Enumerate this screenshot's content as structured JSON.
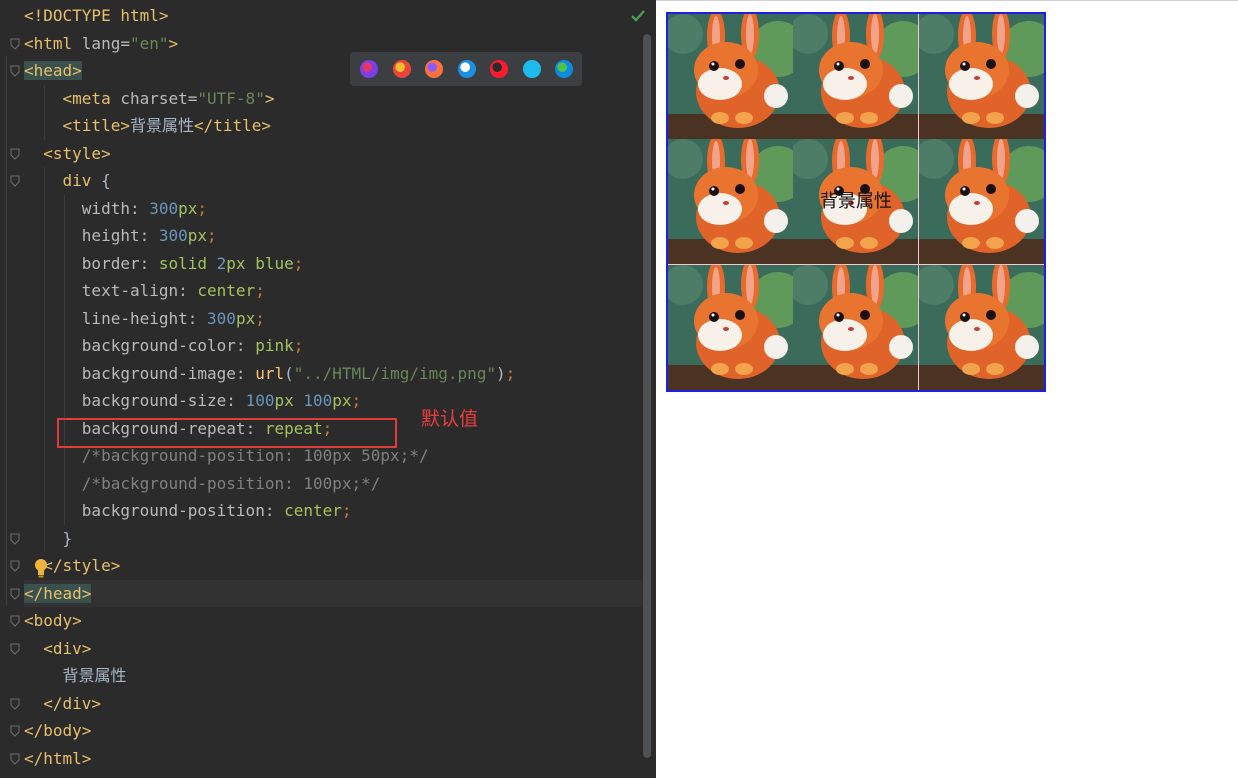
{
  "editor": {
    "lines": [
      [
        {
          "t": "<!DOCTYPE html>",
          "c": "t-doctype"
        }
      ],
      [
        {
          "t": "<html ",
          "c": "t-tag"
        },
        {
          "t": "lang=",
          "c": "t-attr"
        },
        {
          "t": "\"en\"",
          "c": "t-str"
        },
        {
          "t": ">",
          "c": "t-tag"
        }
      ],
      [
        {
          "t": "<head>",
          "c": "t-tag tag-match"
        }
      ],
      [
        {
          "t": "    "
        },
        {
          "t": "<meta ",
          "c": "t-tag"
        },
        {
          "t": "charset=",
          "c": "t-attr"
        },
        {
          "t": "\"UTF-8\"",
          "c": "t-str"
        },
        {
          "t": ">",
          "c": "t-tag"
        }
      ],
      [
        {
          "t": "    "
        },
        {
          "t": "<title>",
          "c": "t-tag"
        },
        {
          "t": "背景属性",
          "c": "t-text"
        },
        {
          "t": "</title>",
          "c": "t-tag"
        }
      ],
      [
        {
          "t": "  "
        },
        {
          "t": "<style>",
          "c": "t-tag"
        }
      ],
      [
        {
          "t": "    "
        },
        {
          "t": "div ",
          "c": "t-tag"
        },
        {
          "t": "{",
          "c": "t-text"
        }
      ],
      [
        {
          "t": "      "
        },
        {
          "t": "width",
          "c": "t-prop"
        },
        {
          "t": ": ",
          "c": "t-text"
        },
        {
          "t": "300",
          "c": "t-num"
        },
        {
          "t": "px",
          "c": "t-kw"
        },
        {
          "t": ";",
          "c": "t-punc"
        }
      ],
      [
        {
          "t": "      "
        },
        {
          "t": "height",
          "c": "t-prop"
        },
        {
          "t": ": ",
          "c": "t-text"
        },
        {
          "t": "300",
          "c": "t-num"
        },
        {
          "t": "px",
          "c": "t-kw"
        },
        {
          "t": ";",
          "c": "t-punc"
        }
      ],
      [
        {
          "t": "      "
        },
        {
          "t": "border",
          "c": "t-prop"
        },
        {
          "t": ": ",
          "c": "t-text"
        },
        {
          "t": "solid ",
          "c": "t-kw"
        },
        {
          "t": "2",
          "c": "t-num"
        },
        {
          "t": "px ",
          "c": "t-kw"
        },
        {
          "t": "blue",
          "c": "t-kw"
        },
        {
          "t": ";",
          "c": "t-punc"
        }
      ],
      [
        {
          "t": "      "
        },
        {
          "t": "text-align",
          "c": "t-prop"
        },
        {
          "t": ": ",
          "c": "t-text"
        },
        {
          "t": "center",
          "c": "t-kw"
        },
        {
          "t": ";",
          "c": "t-punc"
        }
      ],
      [
        {
          "t": "      "
        },
        {
          "t": "line-height",
          "c": "t-prop"
        },
        {
          "t": ": ",
          "c": "t-text"
        },
        {
          "t": "300",
          "c": "t-num"
        },
        {
          "t": "px",
          "c": "t-kw"
        },
        {
          "t": ";",
          "c": "t-punc"
        }
      ],
      [
        {
          "t": "      "
        },
        {
          "t": "background-color",
          "c": "t-prop"
        },
        {
          "t": ": ",
          "c": "t-text"
        },
        {
          "t": "pink",
          "c": "t-kw"
        },
        {
          "t": ";",
          "c": "t-punc"
        }
      ],
      [
        {
          "t": "      "
        },
        {
          "t": "background-image",
          "c": "t-prop"
        },
        {
          "t": ": ",
          "c": "t-text"
        },
        {
          "t": "url",
          "c": "t-fn"
        },
        {
          "t": "(",
          "c": "t-text"
        },
        {
          "t": "\"../HTML/img/img.png\"",
          "c": "t-str"
        },
        {
          "t": ")",
          "c": "t-text"
        },
        {
          "t": ";",
          "c": "t-punc"
        }
      ],
      [
        {
          "t": "      "
        },
        {
          "t": "background-size",
          "c": "t-prop"
        },
        {
          "t": ": ",
          "c": "t-text"
        },
        {
          "t": "100",
          "c": "t-num"
        },
        {
          "t": "px ",
          "c": "t-kw"
        },
        {
          "t": "100",
          "c": "t-num"
        },
        {
          "t": "px",
          "c": "t-kw"
        },
        {
          "t": ";",
          "c": "t-punc"
        }
      ],
      [
        {
          "t": "      "
        },
        {
          "t": "background-repeat",
          "c": "t-prop"
        },
        {
          "t": ": ",
          "c": "t-text"
        },
        {
          "t": "repeat",
          "c": "t-kw"
        },
        {
          "t": ";",
          "c": "t-punc"
        }
      ],
      [
        {
          "t": "      "
        },
        {
          "t": "/*background-position: 100px 50px;*/",
          "c": "t-cmt"
        }
      ],
      [
        {
          "t": "      "
        },
        {
          "t": "/*background-position: 100px;*/",
          "c": "t-cmt"
        }
      ],
      [
        {
          "t": "      "
        },
        {
          "t": "background-position",
          "c": "t-prop"
        },
        {
          "t": ": ",
          "c": "t-text"
        },
        {
          "t": "center",
          "c": "t-kw"
        },
        {
          "t": ";",
          "c": "t-punc"
        }
      ],
      [
        {
          "t": "    "
        },
        {
          "t": "}",
          "c": "t-text"
        }
      ],
      [
        {
          "t": "  "
        },
        {
          "t": "</style>",
          "c": "t-tag"
        }
      ],
      [
        {
          "t": "</head>",
          "c": "t-tag tag-match"
        }
      ],
      [
        {
          "t": "<body>",
          "c": "t-tag"
        }
      ],
      [
        {
          "t": "  "
        },
        {
          "t": "<div>",
          "c": "t-tag"
        }
      ],
      [
        {
          "t": "    "
        },
        {
          "t": "背景属性",
          "c": "t-text"
        }
      ],
      [
        {
          "t": "  "
        },
        {
          "t": "</div>",
          "c": "t-tag"
        }
      ],
      [
        {
          "t": "</body>",
          "c": "t-tag"
        }
      ],
      [
        {
          "t": "</html>",
          "c": "t-tag"
        }
      ]
    ],
    "annotation": "默认值"
  },
  "browser_icons": [
    "intellij-icon",
    "chrome-icon",
    "firefox-icon",
    "safari-icon",
    "opera-icon",
    "ie-icon",
    "edge-icon"
  ],
  "colors": {
    "editor_bg": "#2b2b2b",
    "annotation_red": "#e83e3e",
    "border_blue": "#1f1fe0",
    "pink": "#f6c8d0"
  },
  "preview": {
    "div_text": "背景属性"
  }
}
